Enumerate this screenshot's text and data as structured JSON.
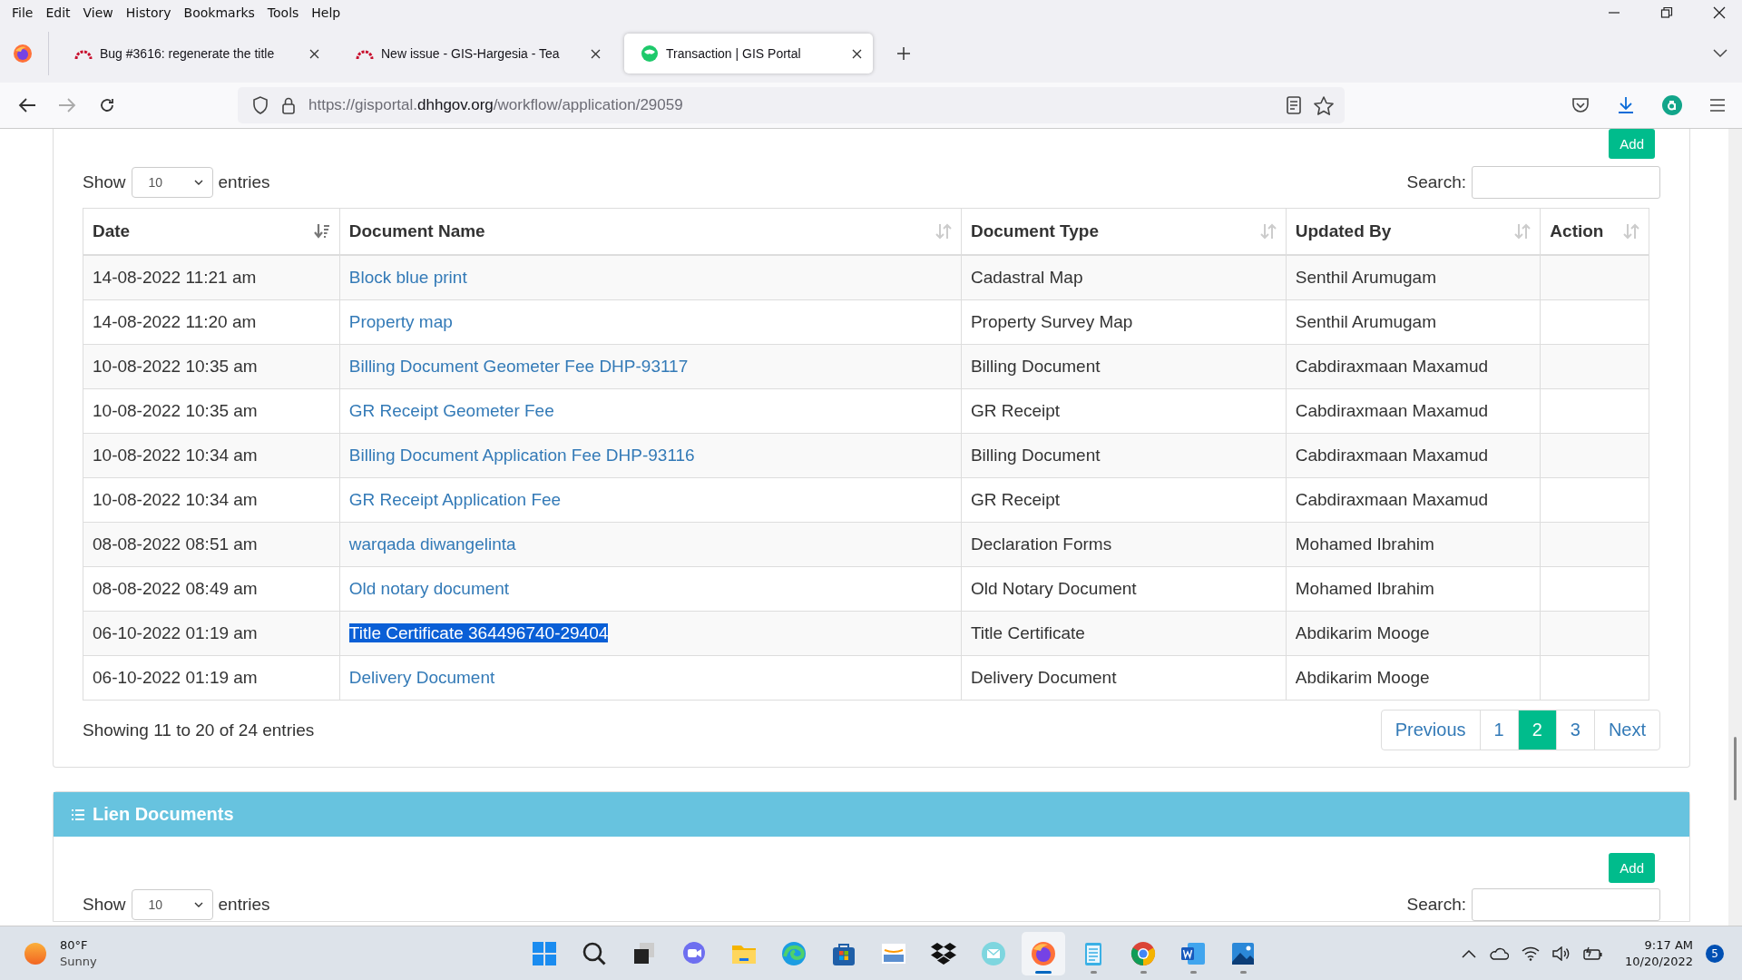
{
  "menu_bar": [
    "File",
    "Edit",
    "View",
    "History",
    "Bookmarks",
    "Tools",
    "Help"
  ],
  "tabs": [
    {
      "kind": "tracker",
      "title": "Bug #3616: regenerate the title",
      "selected": false
    },
    {
      "kind": "tracker",
      "title": "New issue - GIS-Hargesia - Tea",
      "selected": false
    },
    {
      "kind": "portal",
      "title": "Transaction | GIS Portal",
      "selected": true
    }
  ],
  "url": {
    "prefix": "https://gisportal.",
    "domain": "dhhgov.org",
    "path": "/workflow/application/29059"
  },
  "documents": {
    "add_button": "Add",
    "show_label": "Show",
    "page_size": "10",
    "entries_label": "entries",
    "search_label": "Search:",
    "columns": [
      {
        "label": "Date",
        "sorted": true
      },
      {
        "label": "Document Name",
        "sorted": false
      },
      {
        "label": "Document Type",
        "sorted": false
      },
      {
        "label": "Updated By",
        "sorted": false
      },
      {
        "label": "Action",
        "sorted": false
      }
    ],
    "rows": [
      {
        "date": "14-08-2022 11:21 am",
        "name": "Block blue print",
        "type": "Cadastral Map",
        "updated_by": "Senthil Arumugam",
        "highlighted": false
      },
      {
        "date": "14-08-2022 11:20 am",
        "name": "Property map",
        "type": "Property Survey Map",
        "updated_by": "Senthil Arumugam",
        "highlighted": false
      },
      {
        "date": "10-08-2022 10:35 am",
        "name": "Billing Document Geometer Fee DHP-93117",
        "type": "Billing Document",
        "updated_by": "Cabdiraxmaan Maxamud",
        "highlighted": false
      },
      {
        "date": "10-08-2022 10:35 am",
        "name": "GR Receipt Geometer Fee",
        "type": "GR Receipt",
        "updated_by": "Cabdiraxmaan Maxamud",
        "highlighted": false
      },
      {
        "date": "10-08-2022 10:34 am",
        "name": "Billing Document Application Fee DHP-93116",
        "type": "Billing Document",
        "updated_by": "Cabdiraxmaan Maxamud",
        "highlighted": false
      },
      {
        "date": "10-08-2022 10:34 am",
        "name": "GR Receipt Application Fee",
        "type": "GR Receipt",
        "updated_by": "Cabdiraxmaan Maxamud",
        "highlighted": false
      },
      {
        "date": "08-08-2022 08:51 am",
        "name": "warqada diwangelinta",
        "type": "Declaration Forms",
        "updated_by": "Mohamed Ibrahim",
        "highlighted": false
      },
      {
        "date": "08-08-2022 08:49 am",
        "name": "Old notary document",
        "type": "Old Notary Document",
        "updated_by": "Mohamed Ibrahim",
        "highlighted": false
      },
      {
        "date": "06-10-2022 01:19 am",
        "name": "Title Certificate 364496740-29404",
        "type": "Title Certificate",
        "updated_by": "Abdikarim Mooge",
        "highlighted": true
      },
      {
        "date": "06-10-2022 01:19 am",
        "name": "Delivery Document",
        "type": "Delivery Document",
        "updated_by": "Abdikarim Mooge",
        "highlighted": false
      }
    ],
    "info": "Showing 11 to 20 of 24 entries",
    "pagination": [
      {
        "label": "Previous",
        "selected": false
      },
      {
        "label": "1",
        "selected": false
      },
      {
        "label": "2",
        "selected": true
      },
      {
        "label": "3",
        "selected": false
      },
      {
        "label": "Next",
        "selected": false
      }
    ]
  },
  "lien_documents": {
    "title": "Lien Documents",
    "add_button": "Add",
    "show_label": "Show",
    "page_size": "10",
    "entries_label": "entries",
    "search_label": "Search:"
  },
  "taskbar": {
    "weather": {
      "temperature": "80°F",
      "condition": "Sunny"
    },
    "apps": [
      {
        "kind": "start",
        "running": false,
        "active": false
      },
      {
        "kind": "search",
        "running": false,
        "active": false
      },
      {
        "kind": "taskview",
        "running": false,
        "active": false
      },
      {
        "kind": "chat",
        "running": false,
        "active": false
      },
      {
        "kind": "files",
        "running": false,
        "active": false
      },
      {
        "kind": "edge",
        "running": false,
        "active": false
      },
      {
        "kind": "store",
        "running": false,
        "active": false
      },
      {
        "kind": "amazon",
        "running": false,
        "active": false
      },
      {
        "kind": "dropbox",
        "running": false,
        "active": false
      },
      {
        "kind": "mail",
        "running": false,
        "active": false
      },
      {
        "kind": "firefox",
        "running": true,
        "active": true
      },
      {
        "kind": "notepad",
        "running": true,
        "active": false
      },
      {
        "kind": "chrome",
        "running": true,
        "active": false
      },
      {
        "kind": "word",
        "running": true,
        "active": false
      },
      {
        "kind": "photos",
        "running": true,
        "active": false
      }
    ],
    "time": "9:17 AM",
    "date": "10/20/2022",
    "notifications": "5"
  }
}
